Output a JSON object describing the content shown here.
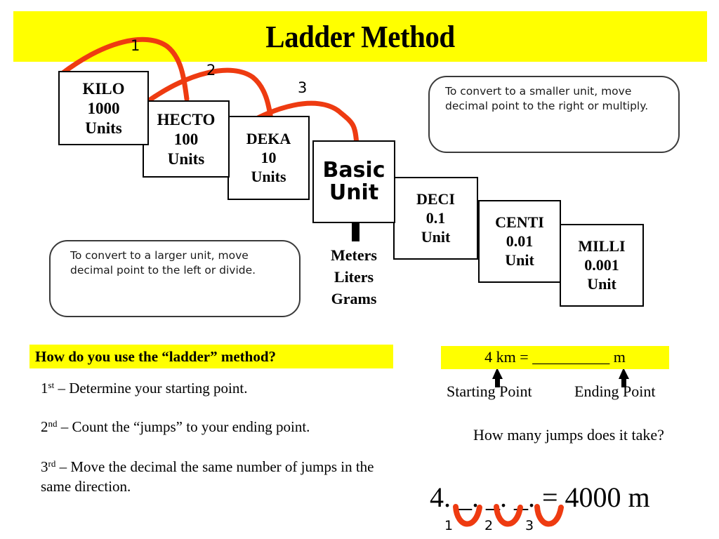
{
  "title": "Ladder Method",
  "colors": {
    "highlight_yellow": "#ffff00",
    "arc_red": "#ee3b11",
    "text_black": "#000000",
    "bubble_border": "#3a3a3a"
  },
  "ladder": {
    "arc_labels": [
      "1",
      "2",
      "3"
    ],
    "steps": [
      {
        "name": "box-kilo",
        "prefix": "KILO",
        "value": "1000",
        "unit": "Units"
      },
      {
        "name": "box-hecto",
        "prefix": "HECTO",
        "value": "100",
        "unit": "Units"
      },
      {
        "name": "box-deka",
        "prefix": "DEKA",
        "value": "10",
        "unit": "Units"
      },
      {
        "name": "box-basic",
        "prefix": "Basic",
        "value": "Unit",
        "unit": ""
      },
      {
        "name": "box-deci",
        "prefix": "DECI",
        "value": "0.1",
        "unit": "Unit"
      },
      {
        "name": "box-centi",
        "prefix": "CENTI",
        "value": "0.01",
        "unit": "Unit"
      },
      {
        "name": "box-milli",
        "prefix": "MILLI",
        "value": "0.001",
        "unit": "Unit"
      }
    ],
    "basic_unit_caption": "Meters\nLiters\nGrams"
  },
  "callouts": {
    "right": "To convert to a smaller unit, move\ndecimal  point to the right or multiply.",
    "left": "To convert to a larger unit, move\ndecimal  point to the left or divide."
  },
  "instructions": {
    "heading": "How do you use the “ladder” method?",
    "steps": [
      {
        "ordinal": "1",
        "suffix": "st",
        "text": " – Determine your starting point."
      },
      {
        "ordinal": "2",
        "suffix": "nd",
        "text": " – Count the “jumps” to your ending point."
      },
      {
        "ordinal": "3",
        "suffix": "rd",
        "text": " – Move the decimal the same number of jumps in the same direction."
      }
    ]
  },
  "example": {
    "equation": "4 km = __________ m",
    "start_label": "Starting Point",
    "end_label": "Ending Point",
    "jumps_question": "How many jumps does it take?",
    "decimal_answer": "4. _. _. _. = 4000 m",
    "jump_labels": [
      "1",
      "2",
      "3"
    ]
  }
}
